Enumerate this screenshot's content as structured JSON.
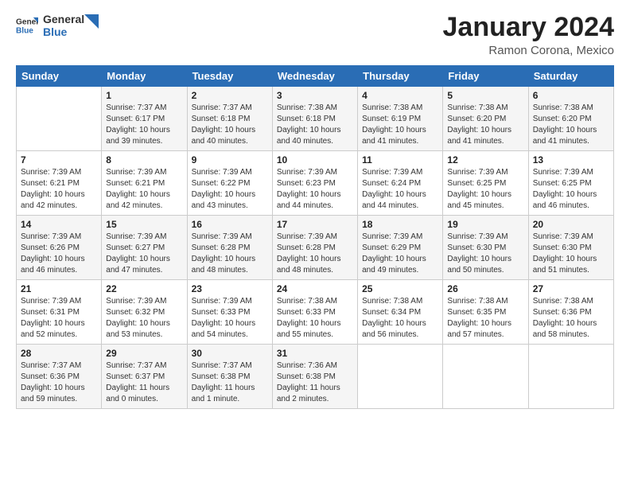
{
  "logo": {
    "text_general": "General",
    "text_blue": "Blue"
  },
  "header": {
    "title": "January 2024",
    "subtitle": "Ramon Corona, Mexico"
  },
  "weekdays": [
    "Sunday",
    "Monday",
    "Tuesday",
    "Wednesday",
    "Thursday",
    "Friday",
    "Saturday"
  ],
  "weeks": [
    [
      {
        "day": "",
        "sunrise": "",
        "sunset": "",
        "daylight": ""
      },
      {
        "day": "1",
        "sunrise": "Sunrise: 7:37 AM",
        "sunset": "Sunset: 6:17 PM",
        "daylight": "Daylight: 10 hours and 39 minutes."
      },
      {
        "day": "2",
        "sunrise": "Sunrise: 7:37 AM",
        "sunset": "Sunset: 6:18 PM",
        "daylight": "Daylight: 10 hours and 40 minutes."
      },
      {
        "day": "3",
        "sunrise": "Sunrise: 7:38 AM",
        "sunset": "Sunset: 6:18 PM",
        "daylight": "Daylight: 10 hours and 40 minutes."
      },
      {
        "day": "4",
        "sunrise": "Sunrise: 7:38 AM",
        "sunset": "Sunset: 6:19 PM",
        "daylight": "Daylight: 10 hours and 41 minutes."
      },
      {
        "day": "5",
        "sunrise": "Sunrise: 7:38 AM",
        "sunset": "Sunset: 6:20 PM",
        "daylight": "Daylight: 10 hours and 41 minutes."
      },
      {
        "day": "6",
        "sunrise": "Sunrise: 7:38 AM",
        "sunset": "Sunset: 6:20 PM",
        "daylight": "Daylight: 10 hours and 41 minutes."
      }
    ],
    [
      {
        "day": "7",
        "sunrise": "Sunrise: 7:39 AM",
        "sunset": "Sunset: 6:21 PM",
        "daylight": "Daylight: 10 hours and 42 minutes."
      },
      {
        "day": "8",
        "sunrise": "Sunrise: 7:39 AM",
        "sunset": "Sunset: 6:21 PM",
        "daylight": "Daylight: 10 hours and 42 minutes."
      },
      {
        "day": "9",
        "sunrise": "Sunrise: 7:39 AM",
        "sunset": "Sunset: 6:22 PM",
        "daylight": "Daylight: 10 hours and 43 minutes."
      },
      {
        "day": "10",
        "sunrise": "Sunrise: 7:39 AM",
        "sunset": "Sunset: 6:23 PM",
        "daylight": "Daylight: 10 hours and 44 minutes."
      },
      {
        "day": "11",
        "sunrise": "Sunrise: 7:39 AM",
        "sunset": "Sunset: 6:24 PM",
        "daylight": "Daylight: 10 hours and 44 minutes."
      },
      {
        "day": "12",
        "sunrise": "Sunrise: 7:39 AM",
        "sunset": "Sunset: 6:25 PM",
        "daylight": "Daylight: 10 hours and 45 minutes."
      },
      {
        "day": "13",
        "sunrise": "Sunrise: 7:39 AM",
        "sunset": "Sunset: 6:25 PM",
        "daylight": "Daylight: 10 hours and 46 minutes."
      }
    ],
    [
      {
        "day": "14",
        "sunrise": "Sunrise: 7:39 AM",
        "sunset": "Sunset: 6:26 PM",
        "daylight": "Daylight: 10 hours and 46 minutes."
      },
      {
        "day": "15",
        "sunrise": "Sunrise: 7:39 AM",
        "sunset": "Sunset: 6:27 PM",
        "daylight": "Daylight: 10 hours and 47 minutes."
      },
      {
        "day": "16",
        "sunrise": "Sunrise: 7:39 AM",
        "sunset": "Sunset: 6:28 PM",
        "daylight": "Daylight: 10 hours and 48 minutes."
      },
      {
        "day": "17",
        "sunrise": "Sunrise: 7:39 AM",
        "sunset": "Sunset: 6:28 PM",
        "daylight": "Daylight: 10 hours and 48 minutes."
      },
      {
        "day": "18",
        "sunrise": "Sunrise: 7:39 AM",
        "sunset": "Sunset: 6:29 PM",
        "daylight": "Daylight: 10 hours and 49 minutes."
      },
      {
        "day": "19",
        "sunrise": "Sunrise: 7:39 AM",
        "sunset": "Sunset: 6:30 PM",
        "daylight": "Daylight: 10 hours and 50 minutes."
      },
      {
        "day": "20",
        "sunrise": "Sunrise: 7:39 AM",
        "sunset": "Sunset: 6:30 PM",
        "daylight": "Daylight: 10 hours and 51 minutes."
      }
    ],
    [
      {
        "day": "21",
        "sunrise": "Sunrise: 7:39 AM",
        "sunset": "Sunset: 6:31 PM",
        "daylight": "Daylight: 10 hours and 52 minutes."
      },
      {
        "day": "22",
        "sunrise": "Sunrise: 7:39 AM",
        "sunset": "Sunset: 6:32 PM",
        "daylight": "Daylight: 10 hours and 53 minutes."
      },
      {
        "day": "23",
        "sunrise": "Sunrise: 7:39 AM",
        "sunset": "Sunset: 6:33 PM",
        "daylight": "Daylight: 10 hours and 54 minutes."
      },
      {
        "day": "24",
        "sunrise": "Sunrise: 7:38 AM",
        "sunset": "Sunset: 6:33 PM",
        "daylight": "Daylight: 10 hours and 55 minutes."
      },
      {
        "day": "25",
        "sunrise": "Sunrise: 7:38 AM",
        "sunset": "Sunset: 6:34 PM",
        "daylight": "Daylight: 10 hours and 56 minutes."
      },
      {
        "day": "26",
        "sunrise": "Sunrise: 7:38 AM",
        "sunset": "Sunset: 6:35 PM",
        "daylight": "Daylight: 10 hours and 57 minutes."
      },
      {
        "day": "27",
        "sunrise": "Sunrise: 7:38 AM",
        "sunset": "Sunset: 6:36 PM",
        "daylight": "Daylight: 10 hours and 58 minutes."
      }
    ],
    [
      {
        "day": "28",
        "sunrise": "Sunrise: 7:37 AM",
        "sunset": "Sunset: 6:36 PM",
        "daylight": "Daylight: 10 hours and 59 minutes."
      },
      {
        "day": "29",
        "sunrise": "Sunrise: 7:37 AM",
        "sunset": "Sunset: 6:37 PM",
        "daylight": "Daylight: 11 hours and 0 minutes."
      },
      {
        "day": "30",
        "sunrise": "Sunrise: 7:37 AM",
        "sunset": "Sunset: 6:38 PM",
        "daylight": "Daylight: 11 hours and 1 minute."
      },
      {
        "day": "31",
        "sunrise": "Sunrise: 7:36 AM",
        "sunset": "Sunset: 6:38 PM",
        "daylight": "Daylight: 11 hours and 2 minutes."
      },
      {
        "day": "",
        "sunrise": "",
        "sunset": "",
        "daylight": ""
      },
      {
        "day": "",
        "sunrise": "",
        "sunset": "",
        "daylight": ""
      },
      {
        "day": "",
        "sunrise": "",
        "sunset": "",
        "daylight": ""
      }
    ]
  ]
}
